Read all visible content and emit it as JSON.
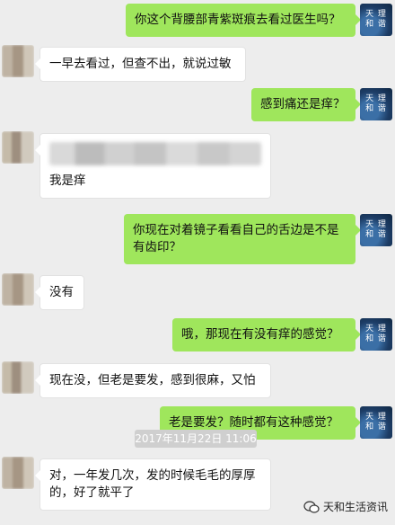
{
  "messages": [
    {
      "side": "right",
      "text": "你这个背腰部青紫斑痕去看过医生吗？"
    },
    {
      "side": "left",
      "text": "一早去看过，但查不出，就说过敏"
    },
    {
      "side": "right",
      "text": "感到痛还是痒？"
    },
    {
      "side": "left",
      "text": "我是痒"
    },
    {
      "side": "right",
      "text": "你现在对着镜子看看自己的舌边是不是有齿印？"
    },
    {
      "side": "left",
      "text": "没有"
    },
    {
      "side": "right",
      "text": "哦，那现在有没有痒的感觉？"
    },
    {
      "side": "left",
      "text": "现在没，但老是要发，感到很麻，又怕"
    },
    {
      "side": "right",
      "text": "老是要发？随时都有这种感觉？"
    },
    {
      "side": "left",
      "text": "对，一年发几次，发的时候毛毛的厚厚的，好了就平了"
    }
  ],
  "timestamp": "2017年11月22日 11:06",
  "doctor_avatar": {
    "line1": "天 理",
    "line2": "和 谐"
  },
  "watermark": "天和生活资讯",
  "colors": {
    "background": "#ededed",
    "sent_bubble": "#9fe65c",
    "received_bubble": "#ffffff"
  }
}
